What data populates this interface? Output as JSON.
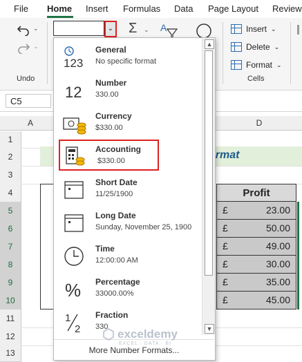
{
  "menubar": {
    "items": [
      "File",
      "Home",
      "Insert",
      "Formulas",
      "Data",
      "Page Layout",
      "Review"
    ],
    "active": "Home"
  },
  "ribbon": {
    "groups": {
      "undo": "Undo",
      "cells": "Cells"
    },
    "cells_buttons": {
      "insert": "Insert",
      "delete": "Delete",
      "format": "Format"
    },
    "format_box_value": ""
  },
  "namebox": {
    "value": "C5"
  },
  "sheet": {
    "columns": [
      "A",
      "D"
    ],
    "rows": [
      "1",
      "2",
      "3",
      "4",
      "5",
      "6",
      "7",
      "8",
      "9",
      "10",
      "11",
      "12",
      "13"
    ],
    "title_fragment": "ormat",
    "profit_header": "Profit",
    "currency_symbol": "£",
    "profit_values": [
      "23.00",
      "50.00",
      "49.00",
      "30.00",
      "35.00",
      "45.00"
    ]
  },
  "number_format_dropdown": {
    "items": [
      {
        "icon": "general-123-icon",
        "title": "General",
        "sample": "No specific format"
      },
      {
        "icon": "number-12-icon",
        "title": "Number",
        "sample": "330.00"
      },
      {
        "icon": "currency-icon",
        "title": "Currency",
        "sample": "$330.00"
      },
      {
        "icon": "accounting-icon",
        "title": "Accounting",
        "sample": " $330.00"
      },
      {
        "icon": "short-date-icon",
        "title": "Short Date",
        "sample": "11/25/1900"
      },
      {
        "icon": "long-date-icon",
        "title": "Long Date",
        "sample": "Sunday, November 25, 1900"
      },
      {
        "icon": "clock-icon",
        "title": "Time",
        "sample": "12:00:00 AM"
      },
      {
        "icon": "percent-icon",
        "title": "Percentage",
        "sample": "33000.00%"
      },
      {
        "icon": "fraction-icon",
        "title": "Fraction",
        "sample": "330"
      }
    ],
    "more_formats": "More Number Formats...",
    "highlighted": "Accounting"
  },
  "watermark": {
    "brand": "exceldemy",
    "tagline": "EXCEL · DATA · BI"
  },
  "colors": {
    "accent_green": "#217346",
    "highlight_red": "#e02020",
    "title_bg": "#e2efda"
  }
}
